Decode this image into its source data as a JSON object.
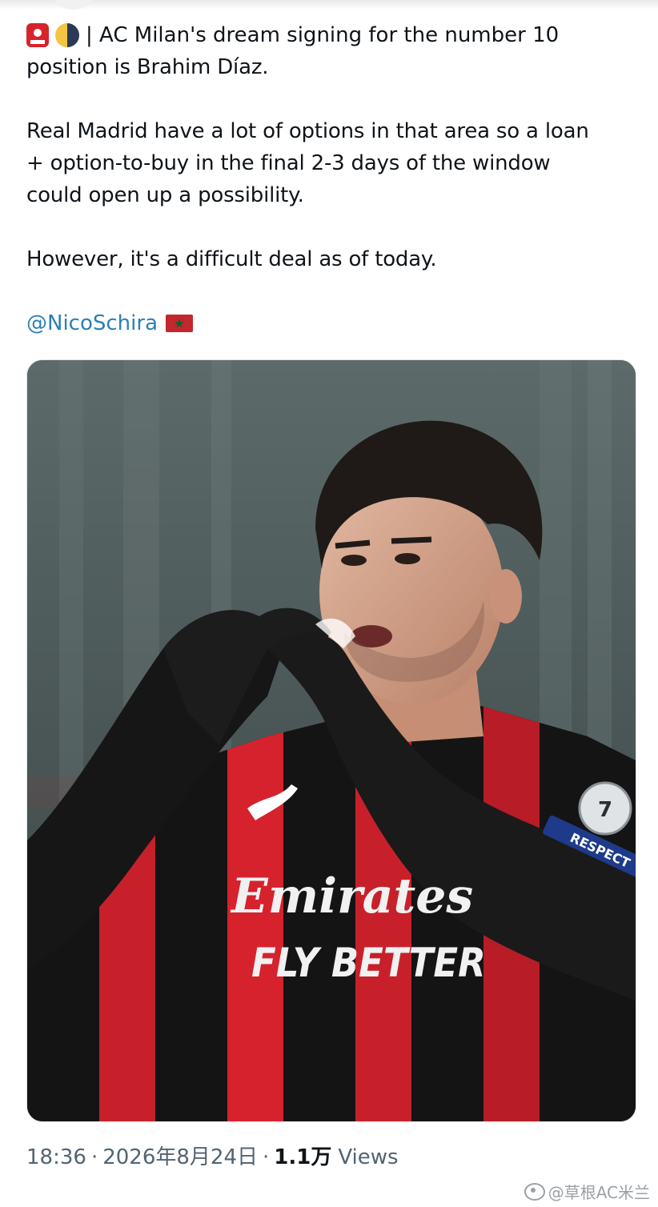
{
  "tweet": {
    "lead_text": "| AC Milan's dream signing for the number 10",
    "lead_text_line2": "position is Brahim Díaz.",
    "para2": "Real Madrid have a lot of options in that area so a loan\n+ option-to-buy in the final 2-3 days of the window\ncould open up a possibility.",
    "para3": "However, it's a difficult deal as of today.",
    "mention": "@NicoSchira",
    "icons": {
      "lead_1": "siren-icon",
      "lead_2": "half-moon-icon",
      "mention_flag": "morocco-flag-icon"
    },
    "link_color": "#2d7fb5"
  },
  "media": {
    "jersey_sponsor_line1": "Emirates",
    "jersey_sponsor_line2": "FLY BETTER",
    "sleeve_badge_text": "RESPECT",
    "sleeve_badge_number": "7"
  },
  "footer": {
    "time": "18:36",
    "separator": "·",
    "date": "2026年8月24日",
    "views_count": "1.1万",
    "views_label": "Views"
  },
  "watermark": {
    "text": "@草根AC米兰",
    "icon": "weibo-icon"
  }
}
